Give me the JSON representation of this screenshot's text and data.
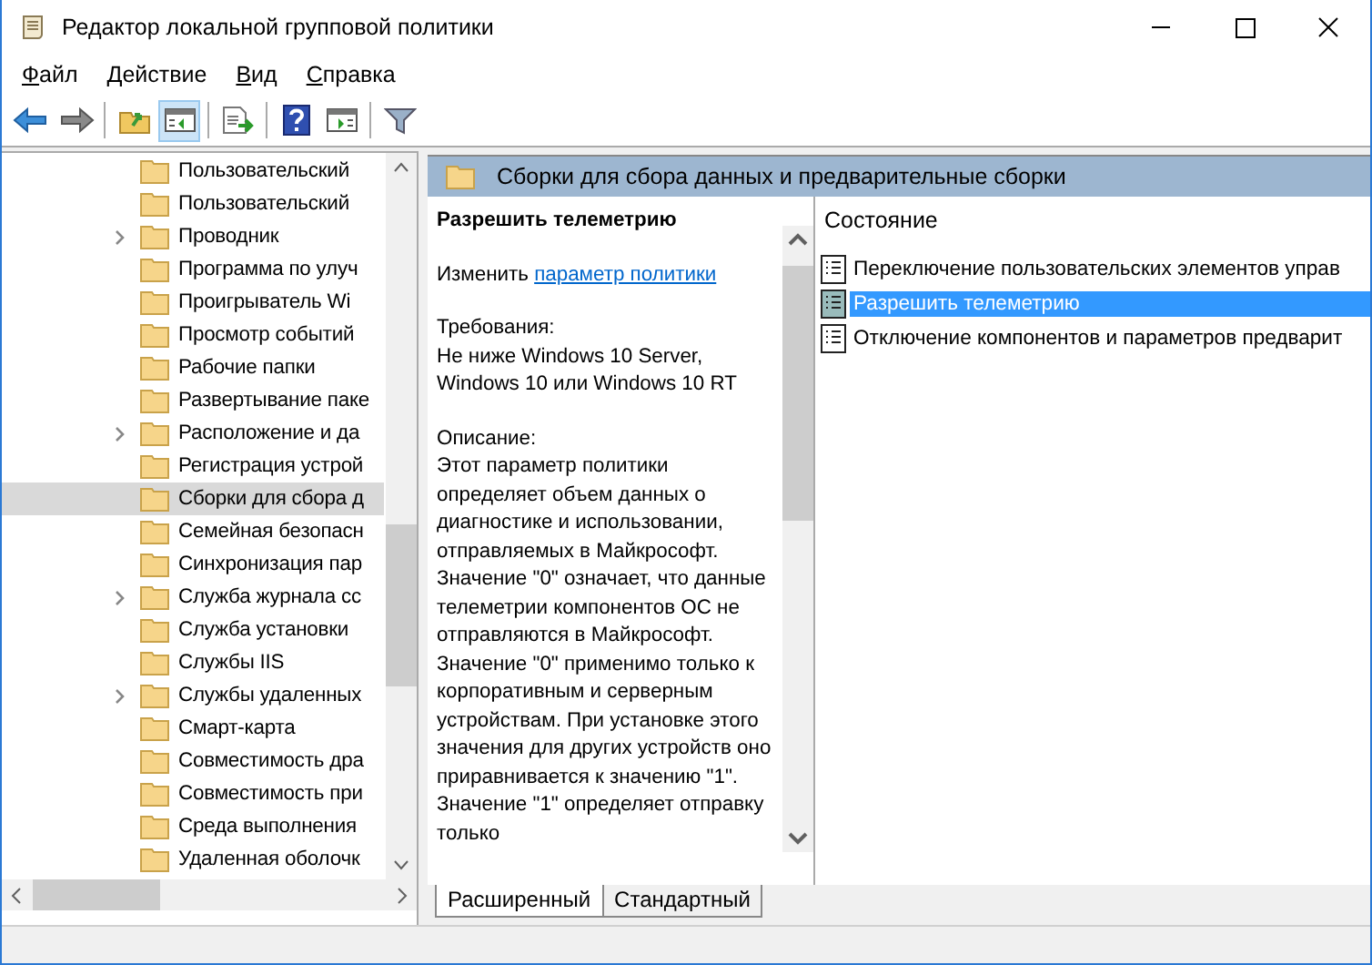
{
  "window": {
    "title": "Редактор локальной групповой политики"
  },
  "menu": [
    "Файл",
    "Действие",
    "Вид",
    "Справка"
  ],
  "toolbar": [
    {
      "kind": "back",
      "pressed": false
    },
    {
      "kind": "forward",
      "pressed": false
    },
    {
      "kind": "sep"
    },
    {
      "kind": "up",
      "pressed": false
    },
    {
      "kind": "tree",
      "pressed": true
    },
    {
      "kind": "sep"
    },
    {
      "kind": "export",
      "pressed": false
    },
    {
      "kind": "sep"
    },
    {
      "kind": "help",
      "pressed": false
    },
    {
      "kind": "pane",
      "pressed": false
    },
    {
      "kind": "sep"
    },
    {
      "kind": "filter",
      "pressed": false
    }
  ],
  "tree": {
    "items": [
      {
        "label": "Пользовательский",
        "expandable": false,
        "selected": false
      },
      {
        "label": "Пользовательский",
        "expandable": false,
        "selected": false
      },
      {
        "label": "Проводник",
        "expandable": true,
        "selected": false
      },
      {
        "label": "Программа по улуч",
        "expandable": false,
        "selected": false
      },
      {
        "label": "Проигрыватель Wi",
        "expandable": false,
        "selected": false
      },
      {
        "label": "Просмотр событий",
        "expandable": false,
        "selected": false
      },
      {
        "label": "Рабочие папки",
        "expandable": false,
        "selected": false
      },
      {
        "label": "Развертывание паке",
        "expandable": false,
        "selected": false
      },
      {
        "label": "Расположение и да",
        "expandable": true,
        "selected": false
      },
      {
        "label": "Регистрация устрой",
        "expandable": false,
        "selected": false
      },
      {
        "label": "Сборки для сбора д",
        "expandable": false,
        "selected": true
      },
      {
        "label": "Семейная безопасн",
        "expandable": false,
        "selected": false
      },
      {
        "label": "Синхронизация пар",
        "expandable": false,
        "selected": false
      },
      {
        "label": "Служба журнала сс",
        "expandable": true,
        "selected": false
      },
      {
        "label": "Служба установки",
        "expandable": false,
        "selected": false
      },
      {
        "label": "Службы IIS",
        "expandable": false,
        "selected": false
      },
      {
        "label": "Службы удаленных",
        "expandable": true,
        "selected": false
      },
      {
        "label": "Смарт-карта",
        "expandable": false,
        "selected": false
      },
      {
        "label": "Совместимость дра",
        "expandable": false,
        "selected": false
      },
      {
        "label": "Совместимость при",
        "expandable": false,
        "selected": false
      },
      {
        "label": "Среда выполнения",
        "expandable": false,
        "selected": false
      },
      {
        "label": "Удаленная оболочк",
        "expandable": false,
        "selected": false
      }
    ]
  },
  "header": {
    "title": "Сборки для сбора данных и предварительные сборки"
  },
  "description": {
    "title": "Разрешить телеметрию",
    "edit_prefix": "Изменить",
    "edit_link": "параметр политики",
    "requirements_label": "Требования:",
    "requirements": "Не ниже Windows 10 Server, Windows 10 или Windows 10 RT",
    "description_label": "Описание:",
    "text": "Этот параметр политики определяет объем данных о диагностике и использовании, отправляемых в Майкрософт. Значение \"0\" означает, что данные телеметрии компонентов ОС не отправляются в Майкрософт. Значение \"0\" применимо только к корпоративным и серверным устройствам. При установке этого значения для других устройств оно приравнивается к значению \"1\". Значение \"1\" определяет отправку только"
  },
  "settings": {
    "column": "Состояние",
    "rows": [
      {
        "label": "Переключение пользовательских элементов управ",
        "selected": false
      },
      {
        "label": "Разрешить телеметрию",
        "selected": true
      },
      {
        "label": "Отключение компонентов и параметров предварит",
        "selected": false
      }
    ]
  },
  "tabs": [
    {
      "label": "Расширенный",
      "selected": true
    },
    {
      "label": "Стандартный",
      "selected": false
    }
  ]
}
